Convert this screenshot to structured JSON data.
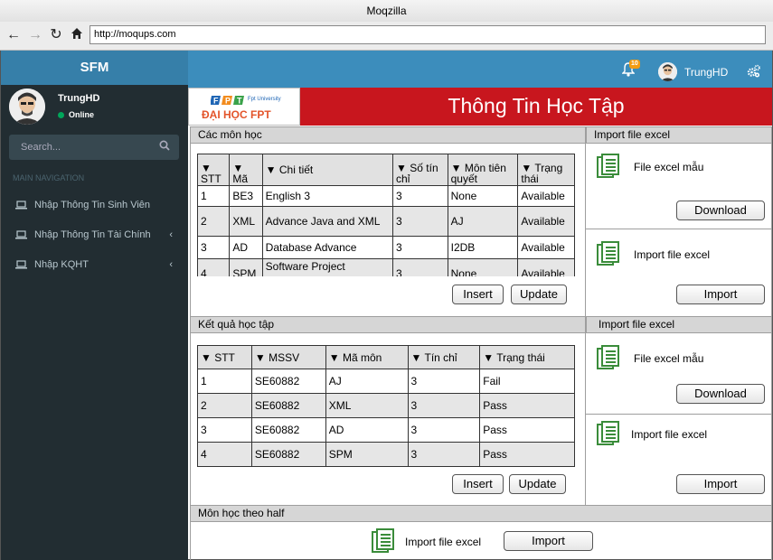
{
  "browser": {
    "title": "Moqzilla",
    "url": "http://moqups.com"
  },
  "sidebar": {
    "logo": "SFM",
    "user": {
      "name": "TrungHD",
      "status": "Online"
    },
    "search_placeholder": "Search...",
    "section_label": "MAIN NAVIGATION",
    "items": [
      {
        "label": "Nhập Thông Tin Sinh Viên"
      },
      {
        "label": "Nhập Thông Tin Tài Chính"
      },
      {
        "label": "Nhập KQHT"
      }
    ]
  },
  "header": {
    "notification_count": "10",
    "user_name": "TrungHD"
  },
  "banner": {
    "logo_small": "Fpt University",
    "logo_text": "ĐẠI HỌC FPT",
    "title": "Thông Tin Học Tập"
  },
  "courses": {
    "title": "Các môn học",
    "columns": [
      "STT",
      "Mã",
      "Chi tiết",
      "Số tín chỉ",
      "Môn tiên quyết",
      "Trạng thái"
    ],
    "rows": [
      [
        "1",
        "BE3",
        "English 3",
        "3",
        "None",
        "Available"
      ],
      [
        "2",
        "XML",
        "Advance Java and XML",
        "3",
        "AJ",
        "Available"
      ],
      [
        "3",
        "AD",
        "Database Advance",
        "3",
        "I2DB",
        "Available"
      ],
      [
        "4",
        "SPM",
        "Software Project",
        "3",
        "None",
        "Available"
      ]
    ],
    "insert_label": "Insert",
    "update_label": "Update"
  },
  "import_panel_1": {
    "title": "Import file excel",
    "template_label": "File excel mẫu",
    "download_label": "Download",
    "import_label_text": "Import file excel",
    "import_button": "Import"
  },
  "results": {
    "title": "Kết quả học tập",
    "columns": [
      "STT",
      "MSSV",
      "Mã môn",
      "Tín chỉ",
      "Trạng thái"
    ],
    "rows": [
      [
        "1",
        "SE60882",
        "AJ",
        "3",
        "Fail"
      ],
      [
        "2",
        "SE60882",
        "XML",
        "3",
        "Pass"
      ],
      [
        "3",
        "SE60882",
        "AD",
        "3",
        "Pass"
      ],
      [
        "4",
        "SE60882",
        "SPM",
        "3",
        "Pass"
      ]
    ],
    "insert_label": "Insert",
    "update_label": "Update"
  },
  "import_panel_2": {
    "title": "Import file excel",
    "template_label": "File excel mẫu",
    "download_label": "Download",
    "import_label_text": "Import file excel",
    "import_button": "Import"
  },
  "half": {
    "title": "Môn học theo half",
    "import_label_text": "Import file excel",
    "import_button": "Import"
  },
  "colors": {
    "sidebar": "#222d32",
    "logo": "#367fa9",
    "topbar": "#3c8dbc",
    "banner": "#c8161e",
    "excel_green": "#3a8c3a"
  }
}
